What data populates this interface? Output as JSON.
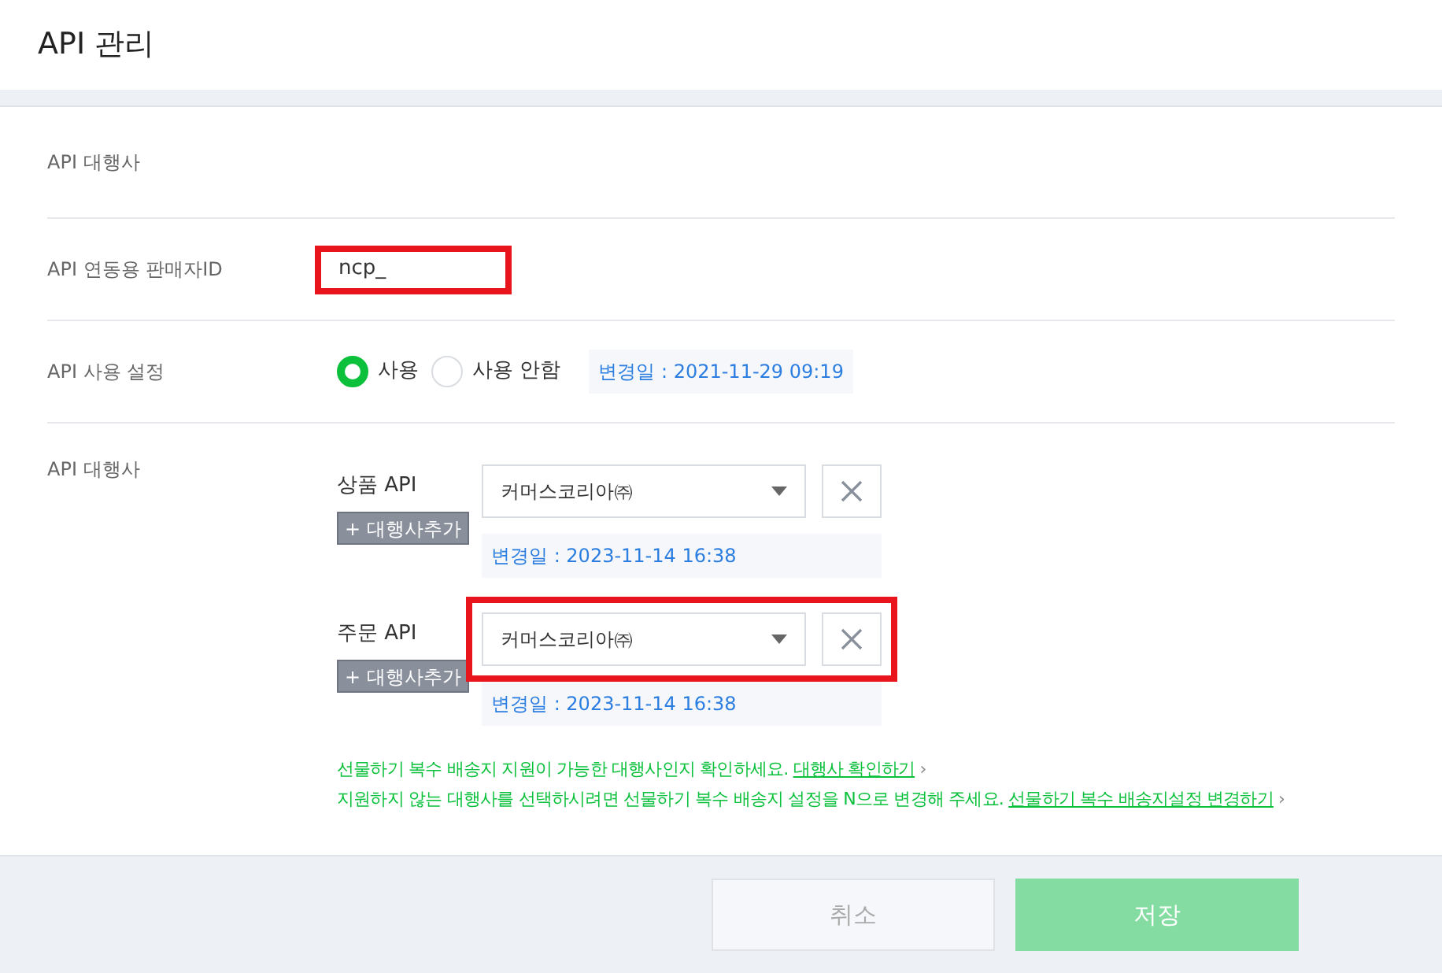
{
  "title": "API 관리",
  "rows": [
    {
      "kind": "text",
      "label": "API 대행사"
    },
    {
      "kind": "input",
      "label": "API 연동용 판매자ID",
      "value": "ncp_",
      "highlighted": true
    },
    {
      "kind": "radio",
      "label": "API 사용 설정",
      "options": [
        {
          "label": "사용",
          "selected": true
        },
        {
          "label": "사용 안함",
          "selected": false
        }
      ],
      "changed": "변경일 : 2021-11-29 09:19"
    },
    {
      "kind": "agencies",
      "label": "API 대행사",
      "groups": [
        {
          "label": "상품 API",
          "add": "+ 대행사추가",
          "value": "커머스코리아㈜",
          "changed": "변경일 : 2023-11-14 16:38",
          "highlighted": false
        },
        {
          "label": "주문 API",
          "add": "+ 대행사추가",
          "value": "커머스코리아㈜",
          "changed": "변경일 : 2023-11-14 16:38",
          "highlighted": true
        }
      ],
      "notes": [
        {
          "text": "선물하기 복수 배송지 지원이 가능한 대행사인지 확인하세요.",
          "link": "대행사 확인하기",
          "chevron": "›"
        },
        {
          "text": "지원하지 않는 대행사를 선택하시려면 선물하기 복수 배송지 설정을 N으로 변경해 주세요.",
          "link": "선물하기 복수 배송지설정 변경하기",
          "chevron": "›"
        }
      ]
    }
  ],
  "buttons": [
    {
      "label": "취소",
      "kind": "cancel"
    },
    {
      "label": "저장",
      "kind": "save"
    }
  ]
}
